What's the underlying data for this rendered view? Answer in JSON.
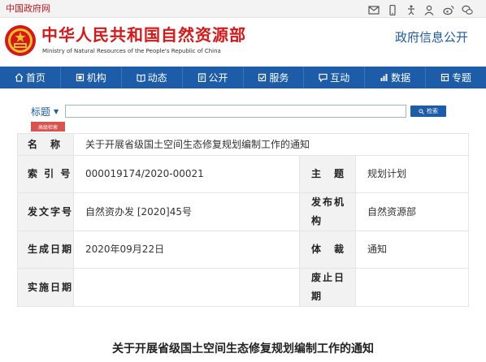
{
  "topbar": {
    "gov_link": "中国政府网",
    "share_icons": [
      "mail-icon",
      "mobile-icon",
      "accessibility-icon",
      "user-icon",
      "weibo-icon",
      "wechat-icon"
    ]
  },
  "header": {
    "site_name": "中华人民共和国自然资源部",
    "site_name_en": "Ministry of Natural Resources of the People's Republic of China",
    "gov_open": "政府信息公开"
  },
  "nav": {
    "items": [
      {
        "label": "首页",
        "icon": "home-icon"
      },
      {
        "label": "机构",
        "icon": "building-icon"
      },
      {
        "label": "动态",
        "icon": "news-icon"
      },
      {
        "label": "公开",
        "icon": "open-icon"
      },
      {
        "label": "服务",
        "icon": "service-icon"
      },
      {
        "label": "互动",
        "icon": "chat-icon"
      },
      {
        "label": "数据",
        "icon": "data-icon"
      },
      {
        "label": "专题",
        "icon": "topic-icon"
      }
    ]
  },
  "search": {
    "select_value": "标题",
    "input_value": "",
    "button_label": "检索",
    "advanced_label": "高级检索"
  },
  "info": {
    "name_label": "名　称",
    "name_value": "关于开展省级国土空间生态修复规划编制工作的通知",
    "index_label": "索 引 号",
    "index_value": "000019174/2020-00021",
    "subject_label": "主　题",
    "subject_value": "规划计划",
    "docno_label": "发文字号",
    "docno_value": "自然资办发 [2020]45号",
    "issuer_label": "发布机构",
    "issuer_value": "自然资源部",
    "date_label": "生成日期",
    "date_value": "2020年09月22日",
    "genre_label": "体　裁",
    "genre_value": "通知",
    "effective_label": "实施日期",
    "effective_value": "",
    "expire_label": "废止日期",
    "expire_value": ""
  },
  "document": {
    "title": "关于开展省级国土空间生态修复规划编制工作的通知"
  },
  "colors": {
    "brand_red": "#d71718",
    "nav_blue": "#1d5ca8",
    "label_bg": "#f2f2f2"
  }
}
